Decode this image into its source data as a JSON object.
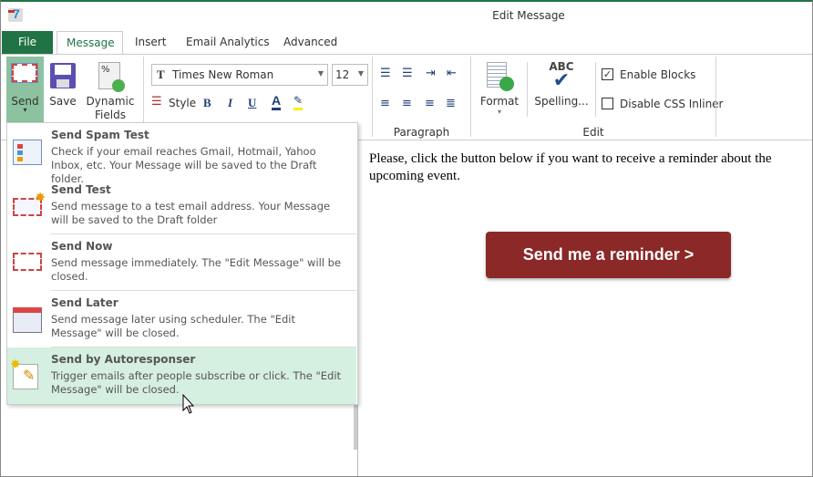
{
  "window": {
    "title": "Edit Message"
  },
  "tabs": [
    {
      "label": "File"
    },
    {
      "label": "Message"
    },
    {
      "label": "Insert"
    },
    {
      "label": "Email Analytics"
    },
    {
      "label": "Advanced"
    }
  ],
  "ribbon": {
    "send": "Send",
    "save": "Save",
    "dynamic_fields": "Dynamic Fields",
    "font_name": "Times New Roman",
    "font_size": "12",
    "style": "Style",
    "bold": "B",
    "italic": "I",
    "underline": "U",
    "font_color": "A",
    "paragraph_group": "Paragraph",
    "format": "Format",
    "spelling": "Spelling...",
    "spelling_icon_text": "ABC",
    "enable_blocks": {
      "label": "Enable Blocks",
      "checked": true
    },
    "disable_css_inliner": {
      "label": "Disable CSS Inliner",
      "checked": false
    },
    "edit_group": "Edit"
  },
  "send_menu": [
    {
      "title": "Send Spam Test",
      "desc": "Check if your email reaches Gmail, Hotmail, Yahoo Inbox, etc. Your Message will be saved to the Draft folder.",
      "icon": "checklist-icon"
    },
    {
      "title": "Send Test",
      "desc": "Send message to a test email address. Your Message will be saved to the Draft folder",
      "icon": "envelope-star-icon"
    },
    {
      "title": "Send Now",
      "desc": "Send message immediately. The \"Edit Message\" will be closed.",
      "icon": "envelope-fast-icon"
    },
    {
      "title": "Send Later",
      "desc": "Send message later using scheduler.  The \"Edit Message\" will be closed.",
      "icon": "calendar-icon"
    },
    {
      "title": "Send by Autoresponser",
      "desc": "Trigger emails after people subscribe or click. The \"Edit Message\" will be closed.",
      "icon": "pencil-spark-icon",
      "highlighted": true
    }
  ],
  "editor": {
    "body_text": "Please, click the button below if you want to receive a reminder about the upcoming event.",
    "cta_button": "Send me a reminder >",
    "cta_color": "#8b2828"
  },
  "colors": {
    "file_tab": "#217346",
    "send_highlight": "#8cc2a0",
    "menu_highlight": "#d5efe0"
  }
}
